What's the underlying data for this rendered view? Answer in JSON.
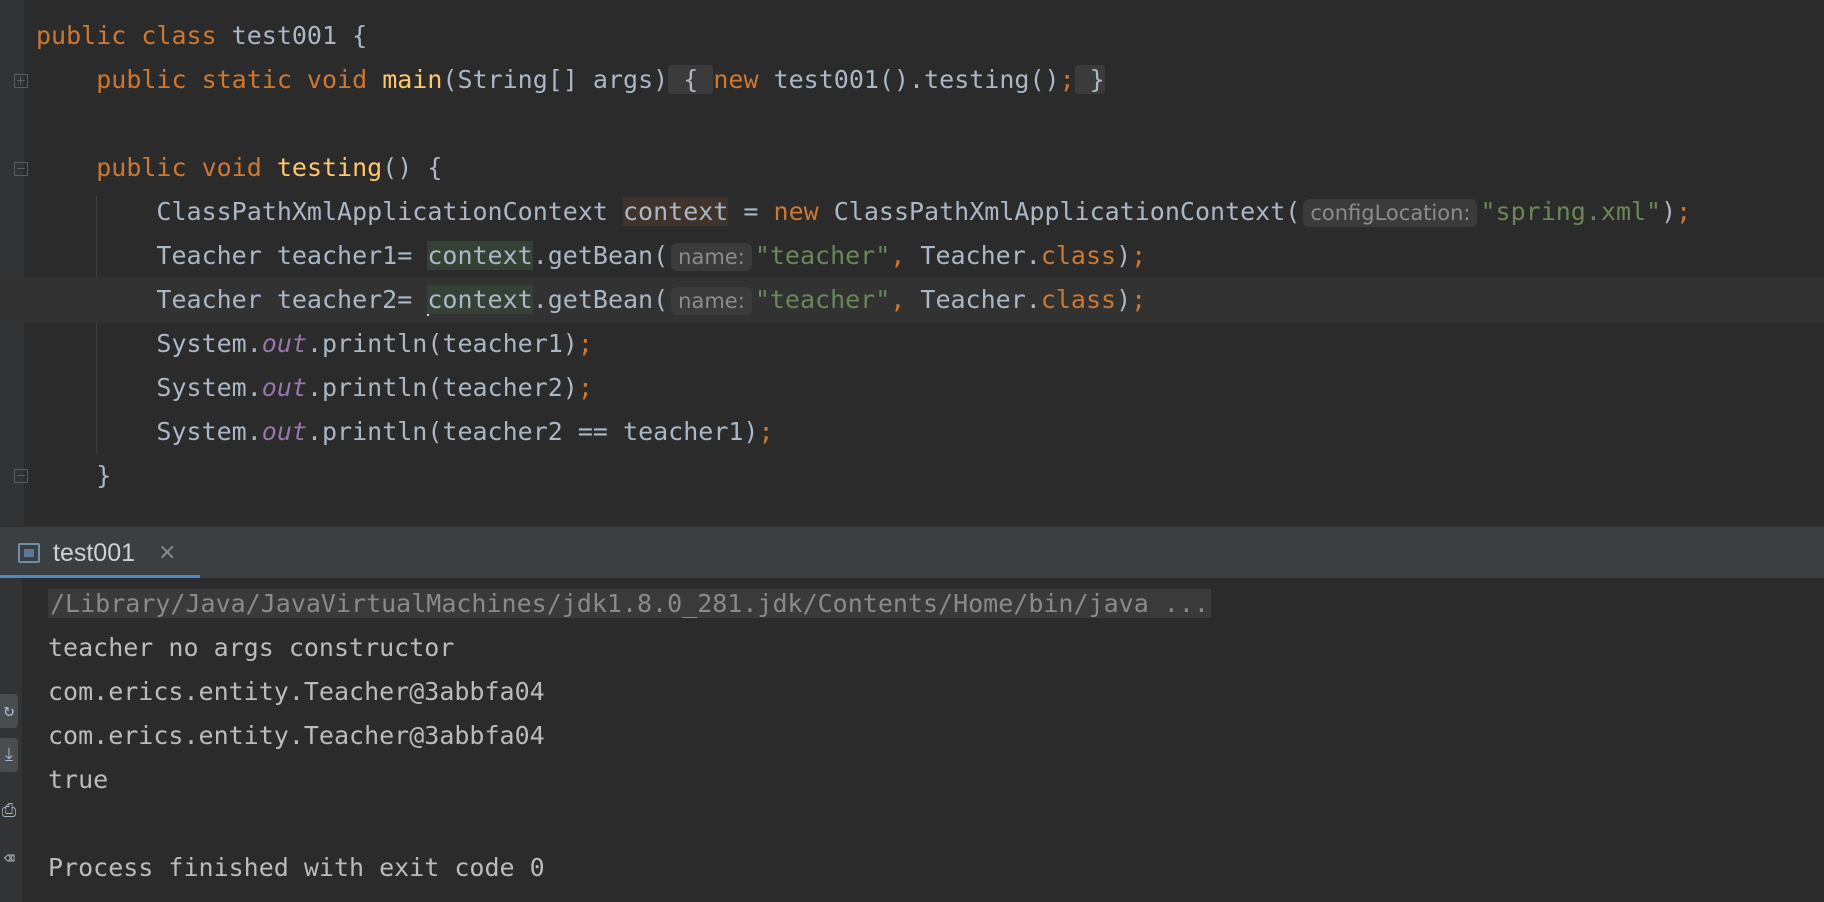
{
  "editor": {
    "lines": [
      {
        "parts": [
          {
            "t": "public class ",
            "c": "kw"
          },
          {
            "t": "test001 {",
            "c": ""
          }
        ]
      },
      {
        "parts": [
          {
            "t": "    ",
            "c": ""
          },
          {
            "t": "public static void ",
            "c": "kw"
          },
          {
            "t": "main",
            "c": "fn"
          },
          {
            "t": "(String[] args)",
            "c": ""
          },
          {
            "t": " { ",
            "c": "fold-mark"
          },
          {
            "t": "new ",
            "c": "kw"
          },
          {
            "t": "test001().testing()",
            "c": ""
          },
          {
            "t": ";",
            "c": "punct"
          },
          {
            "t": " }",
            "c": "fold-mark"
          }
        ]
      },
      {
        "parts": []
      },
      {
        "parts": [
          {
            "t": "    ",
            "c": ""
          },
          {
            "t": "public void ",
            "c": "kw"
          },
          {
            "t": "testing",
            "c": "fn"
          },
          {
            "t": "() {",
            "c": ""
          }
        ]
      },
      {
        "parts": [
          {
            "t": "        ClassPathXmlApplicationContext ",
            "c": ""
          },
          {
            "t": "context",
            "c": "hl-decl"
          },
          {
            "t": " = ",
            "c": ""
          },
          {
            "t": "new ",
            "c": "kw"
          },
          {
            "t": "ClassPathXmlApplicationContext(",
            "c": ""
          },
          {
            "t": "configLocation:",
            "c": "hint"
          },
          {
            "t": "\"spring.xml\"",
            "c": "str"
          },
          {
            "t": ")",
            "c": ""
          },
          {
            "t": ";",
            "c": "punct"
          }
        ]
      },
      {
        "parts": [
          {
            "t": "        Teacher teacher1= ",
            "c": ""
          },
          {
            "t": "context",
            "c": "hl-context"
          },
          {
            "t": ".getBean(",
            "c": ""
          },
          {
            "t": "name:",
            "c": "hint"
          },
          {
            "t": "\"teacher\"",
            "c": "str"
          },
          {
            "t": ", ",
            "c": "punct"
          },
          {
            "t": "Teacher.",
            "c": ""
          },
          {
            "t": "class",
            "c": "kw"
          },
          {
            "t": ")",
            "c": ""
          },
          {
            "t": ";",
            "c": "punct"
          }
        ]
      },
      {
        "parts": [
          {
            "t": "        Teacher teacher2= ",
            "c": ""
          },
          {
            "t": "",
            "c": "caret"
          },
          {
            "t": "context",
            "c": "hl-context"
          },
          {
            "t": ".getBean(",
            "c": ""
          },
          {
            "t": "name:",
            "c": "hint"
          },
          {
            "t": "\"teacher\"",
            "c": "str"
          },
          {
            "t": ", ",
            "c": "punct"
          },
          {
            "t": "Teacher.",
            "c": ""
          },
          {
            "t": "class",
            "c": "kw"
          },
          {
            "t": ")",
            "c": ""
          },
          {
            "t": ";",
            "c": "punct"
          }
        ]
      },
      {
        "parts": [
          {
            "t": "        System.",
            "c": ""
          },
          {
            "t": "out",
            "c": "fld"
          },
          {
            "t": ".println(teacher1)",
            "c": ""
          },
          {
            "t": ";",
            "c": "punct"
          }
        ]
      },
      {
        "parts": [
          {
            "t": "        System.",
            "c": ""
          },
          {
            "t": "out",
            "c": "fld"
          },
          {
            "t": ".println(teacher2)",
            "c": ""
          },
          {
            "t": ";",
            "c": "punct"
          }
        ]
      },
      {
        "parts": [
          {
            "t": "        System.",
            "c": ""
          },
          {
            "t": "out",
            "c": "fld"
          },
          {
            "t": ".println(teacher2 == teacher1)",
            "c": ""
          },
          {
            "t": ";",
            "c": "punct"
          }
        ]
      },
      {
        "parts": [
          {
            "t": "    }",
            "c": ""
          }
        ]
      }
    ]
  },
  "run_panel": {
    "tab_label": "test001",
    "close_glyph": "×"
  },
  "console": {
    "command": "/Library/Java/JavaVirtualMachines/jdk1.8.0_281.jdk/Contents/Home/bin/java ...",
    "output_lines": [
      "teacher no args constructor",
      "com.erics.entity.Teacher@3abbfa04",
      "com.erics.entity.Teacher@3abbfa04",
      "true",
      "",
      "Process finished with exit code 0"
    ]
  },
  "colors": {
    "keyword": "#cc7832",
    "method": "#ffc66d",
    "string": "#6a8759",
    "field": "#9876aa",
    "text": "#a9b7c6",
    "background": "#2b2b2b"
  }
}
